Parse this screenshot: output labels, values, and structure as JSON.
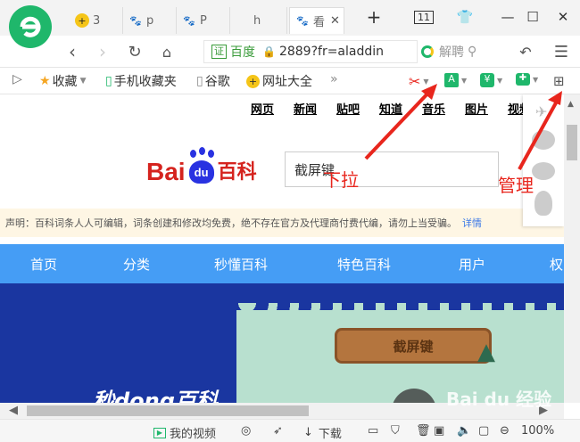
{
  "tabs": [
    {
      "label": "3",
      "icon": "plus-circle-icon",
      "color": "#f5c518"
    },
    {
      "label": "p",
      "icon": "paw-icon",
      "color": "#3b78e7"
    },
    {
      "label": "P",
      "icon": "paw-icon",
      "color": "#3b78e7"
    },
    {
      "label": "h",
      "icon": "blank-icon",
      "color": "#999999"
    },
    {
      "label": "看",
      "icon": "paw-icon",
      "color": "#3b78e7"
    }
  ],
  "window": {
    "tab_count": "11"
  },
  "address": {
    "cert_label": "证",
    "site_name": "百度",
    "url": "2889?fr=aladdin"
  },
  "search": {
    "label": "解聘"
  },
  "bookmarks": [
    {
      "label": "收藏",
      "icon": "star-icon"
    },
    {
      "label": "手机收藏夹",
      "icon": "phone-icon"
    },
    {
      "label": "谷歌",
      "icon": "page-icon"
    },
    {
      "label": "网址大全",
      "icon": "plus-circle-icon"
    }
  ],
  "page": {
    "topnav": [
      "网页",
      "新闻",
      "贴吧",
      "知道",
      "音乐",
      "图片",
      "视频"
    ],
    "logo_bai": "Bai",
    "logo_du": "du",
    "logo_baike": "百科",
    "search_value": "截屏键",
    "notice": "声明：百科词条人人可编辑，词条创建和修改均免费，绝不存在官方及代理商付费代编，请勿上当受骗。",
    "notice_link": "详情",
    "mainnav": [
      "首页",
      "分类",
      "秒懂百科",
      "特色百科",
      "用户",
      "权"
    ],
    "hero_title": "截屏键",
    "hero_text": "秒dong百科",
    "watermark": "Bai du 经验"
  },
  "annotations": {
    "dropdown": "下拉",
    "manage": "管理"
  },
  "status": {
    "video_label": "我的视频",
    "download_label": "下载",
    "zoom": "100%"
  },
  "colors": {
    "accent_blue": "#459df5",
    "annotation_red": "#e8261d",
    "baidu_red": "#d5231e",
    "baidu_blue": "#2932e1"
  }
}
